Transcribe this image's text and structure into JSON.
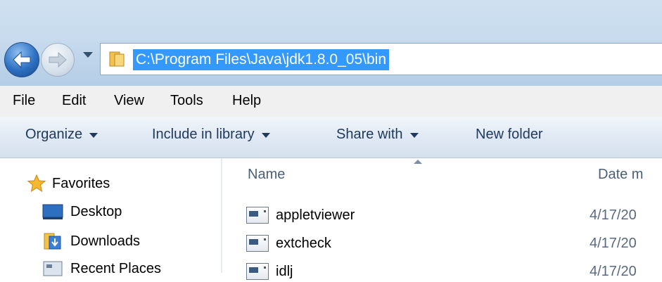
{
  "address_bar": {
    "path": "C:\\Program Files\\Java\\jdk1.8.0_05\\bin",
    "back_icon": "back-arrow-icon",
    "forward_icon": "forward-arrow-icon",
    "history_icon": "chevron-down-icon",
    "folder_icon": "folder-icon"
  },
  "menubar": {
    "items": [
      "File",
      "Edit",
      "View",
      "Tools",
      "Help"
    ]
  },
  "toolbar": {
    "organize": "Organize",
    "include_in_library": "Include in library",
    "share_with": "Share with",
    "new_folder": "New folder"
  },
  "navpane": {
    "favorites": "Favorites",
    "items": [
      "Desktop",
      "Downloads",
      "Recent Places"
    ]
  },
  "filelist": {
    "columns": {
      "name": "Name",
      "date": "Date m"
    },
    "rows": [
      {
        "name": "appletviewer",
        "date": "4/17/20"
      },
      {
        "name": "extcheck",
        "date": "4/17/20"
      },
      {
        "name": "idlj",
        "date": "4/17/20"
      }
    ]
  },
  "colors": {
    "selection": "#3399ff",
    "toolbar_text": "#1e395b",
    "titlebar": "#c9dcef"
  }
}
